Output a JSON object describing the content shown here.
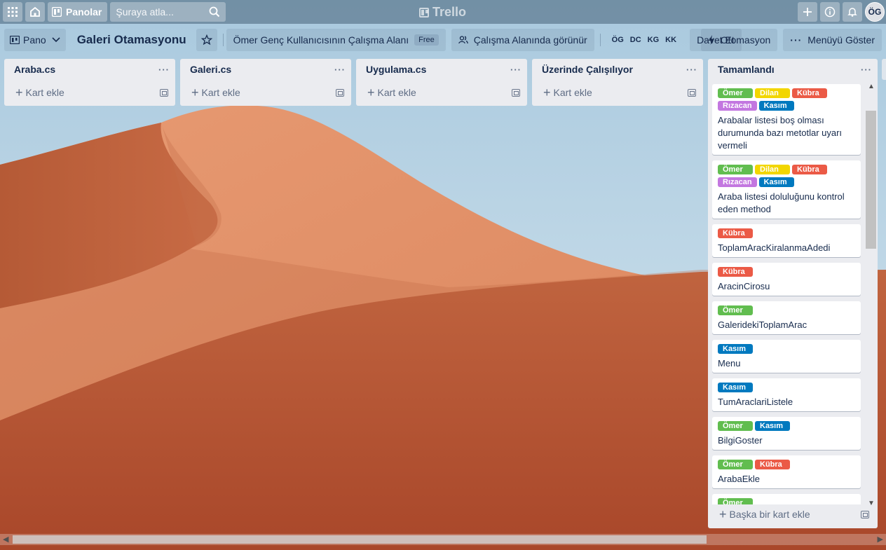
{
  "header": {
    "apps_icon": "grid-icon",
    "home_icon": "home-icon",
    "boards_label": "Panolar",
    "search_placeholder": "Şuraya atla...",
    "logo_text": "Trello",
    "avatar_initials": "ÖG"
  },
  "board": {
    "view_label": "Pano",
    "title": "Galeri Otamasyonu",
    "workspace_label": "Ömer Genç Kullanıcısının Çalışma Alanı",
    "plan_badge": "Free",
    "visibility_label": "Çalışma Alanında görünür",
    "members": [
      "ÖG",
      "DC",
      "KG",
      "KK"
    ],
    "invite_label": "Davet Et",
    "automation_label": "Otomasyon",
    "menu_label": "Menüyü Göster"
  },
  "lists": [
    {
      "title": "Araba.cs",
      "add_label": "Kart ekle"
    },
    {
      "title": "Galeri.cs",
      "add_label": "Kart ekle"
    },
    {
      "title": "Uygulama.cs",
      "add_label": "Kart ekle"
    },
    {
      "title": "Üzerinde Çalışılıyor",
      "add_label": "Kart ekle"
    }
  ],
  "done_list": {
    "title": "Tamamlandı",
    "add_label": "Başka bir kart ekle",
    "cards": [
      {
        "labels": [
          "Ömer",
          "Dilan",
          "Kübra",
          "Rızacan",
          "Kasım"
        ],
        "title": "Arabalar listesi boş olması durumunda bazı metotlar uyarı vermeli"
      },
      {
        "labels": [
          "Ömer",
          "Dilan",
          "Kübra",
          "Rızacan",
          "Kasım"
        ],
        "title": "Araba listesi doluluğunu kontrol eden method"
      },
      {
        "labels": [
          "Kübra"
        ],
        "title": "ToplamAracKiralanmaAdedi"
      },
      {
        "labels": [
          "Kübra"
        ],
        "title": "AracinCirosu"
      },
      {
        "labels": [
          "Ömer"
        ],
        "title": "GaleridekiToplamArac"
      },
      {
        "labels": [
          "Kasım"
        ],
        "title": "Menu"
      },
      {
        "labels": [
          "Kasım"
        ],
        "title": "TumAraclariListele"
      },
      {
        "labels": [
          "Ömer",
          "Kasım"
        ],
        "title": "BilgiGoster"
      },
      {
        "labels": [
          "Ömer",
          "Kübra"
        ],
        "title": "ArabaEkle"
      },
      {
        "labels": [
          "Ömer"
        ],
        "title": ""
      }
    ]
  },
  "label_colors": {
    "Ömer": "#61bd4f",
    "Dilan": "#f2d600",
    "Kübra": "#eb5a46",
    "Rızacan": "#c377e0",
    "Kasım": "#0079bf"
  }
}
